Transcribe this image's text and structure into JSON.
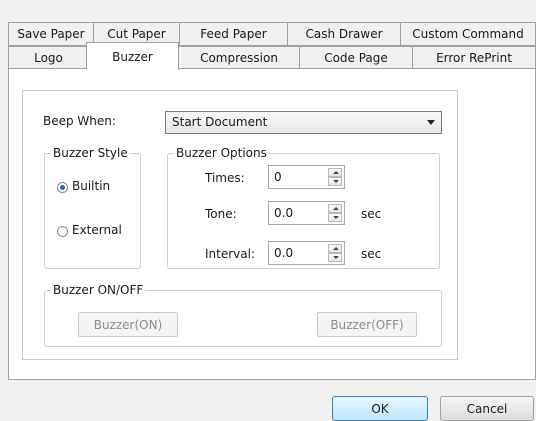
{
  "tabs_row1": [
    "Save Paper",
    "Cut Paper",
    "Feed Paper",
    "Cash Drawer",
    "Custom Command"
  ],
  "tabs_row2": [
    "Logo",
    "Buzzer",
    "Compression",
    "Code Page",
    "Error RePrint"
  ],
  "active_tab": "Buzzer",
  "beep": {
    "label": "Beep When:",
    "selected": "Start Document"
  },
  "buzzer_style": {
    "legend": "Buzzer Style",
    "options": [
      "Builtin",
      "External"
    ],
    "selected": "Builtin"
  },
  "buzzer_options": {
    "legend": "Buzzer Options",
    "times_label": "Times:",
    "times_value": "0",
    "tone_label": "Tone:",
    "tone_value": "0.0",
    "tone_unit": "sec",
    "interval_label": "Interval:",
    "interval_value": "0.0",
    "interval_unit": "sec"
  },
  "buzzer_onoff": {
    "legend": "Buzzer ON/OFF",
    "on_label": "Buzzer(ON)",
    "off_label": "Buzzer(OFF)"
  },
  "footer": {
    "ok": "OK",
    "cancel": "Cancel"
  }
}
